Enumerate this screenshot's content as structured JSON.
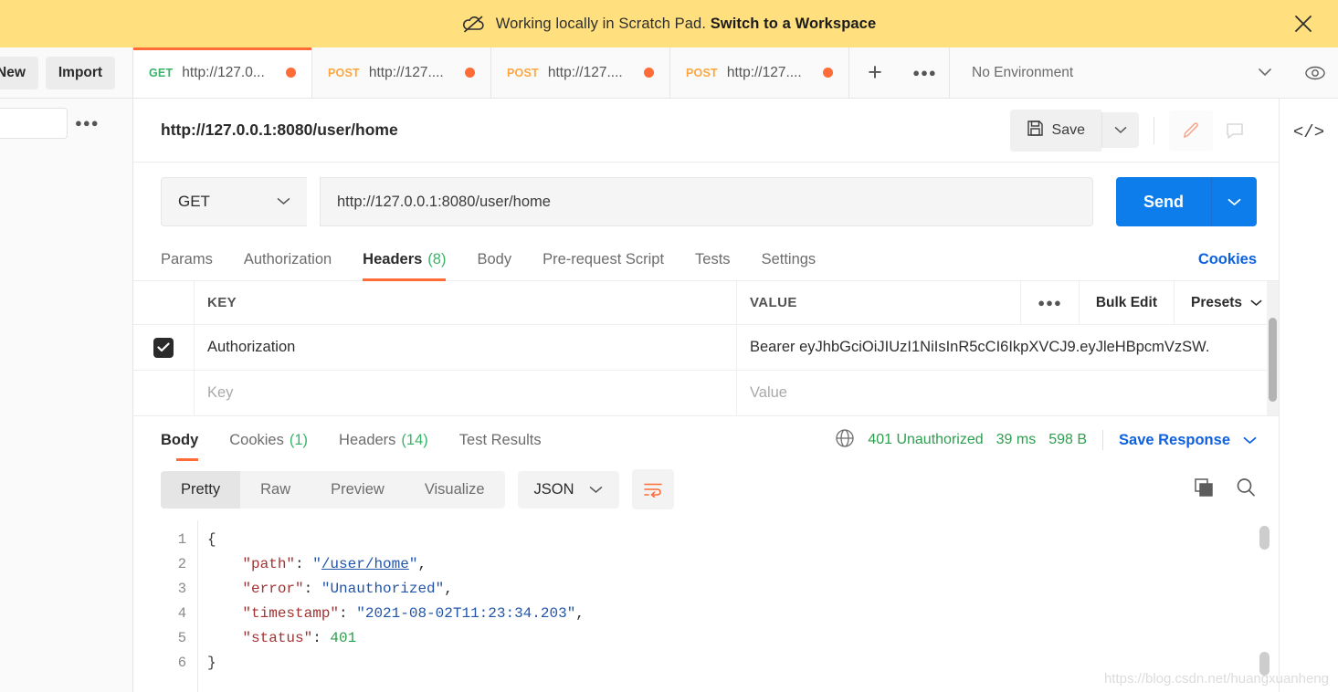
{
  "banner": {
    "icon": "cloud-off-icon",
    "text": "Working locally in Scratch Pad.",
    "link": "Switch to a Workspace",
    "close": "✕"
  },
  "left_actions": {
    "new": "New",
    "import": "Import",
    "more": "●●●"
  },
  "tabs": [
    {
      "method": "GET",
      "url": "http://127.0...",
      "dirty": true,
      "active": true
    },
    {
      "method": "POST",
      "url": "http://127....",
      "dirty": true,
      "active": false
    },
    {
      "method": "POST",
      "url": "http://127....",
      "dirty": true,
      "active": false
    },
    {
      "method": "POST",
      "url": "http://127....",
      "dirty": true,
      "active": false
    }
  ],
  "tabstrip": {
    "add": "+",
    "more": "●●●"
  },
  "environment": {
    "label": "No Environment",
    "caret": "⌄",
    "eye_icon": "eye-icon"
  },
  "right_rail": {
    "code_icon": "</>"
  },
  "request": {
    "title": "http://127.0.0.1:8080/user/home",
    "save_label": "Save",
    "save_caret": "⌄",
    "edit_icon": "pencil-icon",
    "comment_icon": "comment-icon",
    "method": "GET",
    "method_caret": "⌄",
    "url": "http://127.0.0.1:8080/user/home",
    "send_label": "Send",
    "send_caret": "⌄",
    "tabs": [
      {
        "label": "Params",
        "count": "",
        "active": false
      },
      {
        "label": "Authorization",
        "count": "",
        "active": false
      },
      {
        "label": "Headers",
        "count": "(8)",
        "active": true
      },
      {
        "label": "Body",
        "count": "",
        "active": false
      },
      {
        "label": "Pre-request Script",
        "count": "",
        "active": false
      },
      {
        "label": "Tests",
        "count": "",
        "active": false
      },
      {
        "label": "Settings",
        "count": "",
        "active": false
      }
    ],
    "cookies_link": "Cookies"
  },
  "headers_table": {
    "col_key": "KEY",
    "col_value": "VALUE",
    "tools": {
      "dots": "●●●",
      "bulk_edit": "Bulk Edit",
      "presets": "Presets",
      "presets_caret": "⌄"
    },
    "rows": [
      {
        "checked": true,
        "key": "Authorization",
        "value": "Bearer eyJhbGciOiJIUzI1NiIsInR5cCI6IkpXVCJ9.eyJleHBpcmVzSW."
      }
    ],
    "placeholder_row": {
      "key": "Key",
      "value": "Value"
    }
  },
  "response": {
    "tabs": [
      {
        "label": "Body",
        "count": "",
        "active": true
      },
      {
        "label": "Cookies",
        "count": "(1)",
        "active": false
      },
      {
        "label": "Headers",
        "count": "(14)",
        "active": false
      },
      {
        "label": "Test Results",
        "count": "",
        "active": false
      }
    ],
    "globe_icon": "globe-icon",
    "status": "401 Unauthorized",
    "time": "39 ms",
    "size": "598 B",
    "save_response": "Save Response",
    "save_response_caret": "⌄",
    "view_modes": [
      {
        "label": "Pretty",
        "active": true
      },
      {
        "label": "Raw",
        "active": false
      },
      {
        "label": "Preview",
        "active": false
      },
      {
        "label": "Visualize",
        "active": false
      }
    ],
    "language": "JSON",
    "language_caret": "⌄",
    "wrap_icon": "wrap-lines-icon",
    "copy_icon": "copy-icon",
    "search_icon": "search-icon",
    "body": {
      "line_numbers": [
        "1",
        "2",
        "3",
        "4",
        "5",
        "6"
      ],
      "json": {
        "path": "/user/home",
        "error": "Unauthorized",
        "timestamp": "2021-08-02T11:23:34.203",
        "status": 401
      },
      "lines": [
        {
          "n": "1",
          "text": "{"
        },
        {
          "n": "2",
          "text": "    \"path\": \"/user/home\","
        },
        {
          "n": "3",
          "text": "    \"error\": \"Unauthorized\","
        },
        {
          "n": "4",
          "text": "    \"timestamp\": \"2021-08-02T11:23:34.203\","
        },
        {
          "n": "5",
          "text": "    \"status\": 401"
        },
        {
          "n": "6",
          "text": "}"
        }
      ]
    }
  },
  "watermark": "https://blog.csdn.net/huangxuanheng",
  "colors": {
    "banner_bg": "#ffdf7e",
    "accent_orange": "#ff6c37",
    "send_blue": "#0e7dec",
    "link_blue": "#0e61e0",
    "status_green": "#2e9e4f",
    "method_get": "#3ab36a",
    "method_post": "#ffa63f"
  }
}
